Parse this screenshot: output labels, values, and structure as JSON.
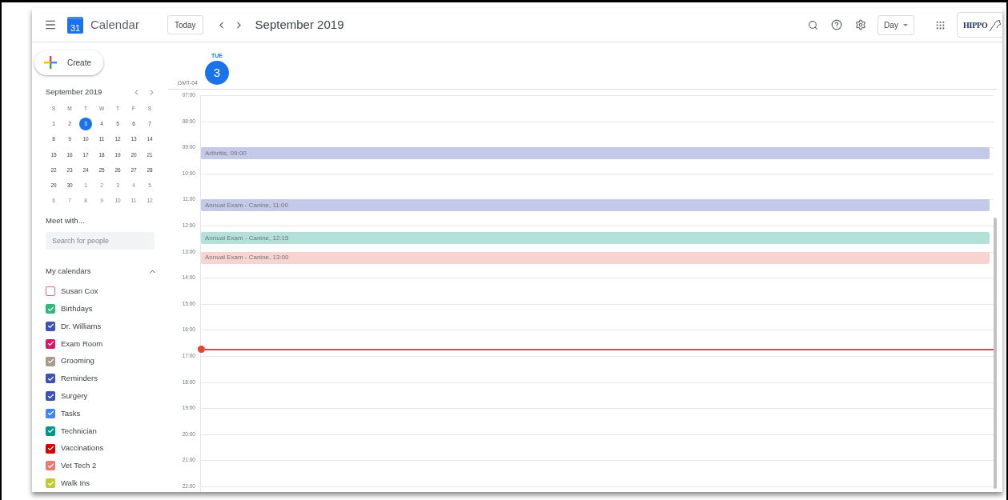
{
  "header": {
    "app_name": "Calendar",
    "logo_day": "31",
    "today_button": "Today",
    "title": "September 2019",
    "view_button": "Day",
    "account_logo": "HIPPO"
  },
  "create_button": "Create",
  "mini_calendar": {
    "title": "September 2019",
    "weekdays": [
      "S",
      "M",
      "T",
      "W",
      "T",
      "F",
      "S"
    ],
    "weeks": [
      [
        {
          "day": "1",
          "muted": false,
          "selected": false
        },
        {
          "day": "2",
          "muted": false,
          "selected": false
        },
        {
          "day": "3",
          "muted": false,
          "selected": true
        },
        {
          "day": "4",
          "muted": false,
          "selected": false
        },
        {
          "day": "5",
          "muted": false,
          "selected": false
        },
        {
          "day": "6",
          "muted": false,
          "selected": false
        },
        {
          "day": "7",
          "muted": false,
          "selected": false
        }
      ],
      [
        {
          "day": "8",
          "muted": false,
          "selected": false
        },
        {
          "day": "9",
          "muted": false,
          "selected": false
        },
        {
          "day": "10",
          "muted": false,
          "selected": false
        },
        {
          "day": "11",
          "muted": false,
          "selected": false
        },
        {
          "day": "12",
          "muted": false,
          "selected": false
        },
        {
          "day": "13",
          "muted": false,
          "selected": false
        },
        {
          "day": "14",
          "muted": false,
          "selected": false
        }
      ],
      [
        {
          "day": "15",
          "muted": false,
          "selected": false
        },
        {
          "day": "16",
          "muted": false,
          "selected": false
        },
        {
          "day": "17",
          "muted": false,
          "selected": false
        },
        {
          "day": "18",
          "muted": false,
          "selected": false
        },
        {
          "day": "19",
          "muted": false,
          "selected": false
        },
        {
          "day": "20",
          "muted": false,
          "selected": false
        },
        {
          "day": "21",
          "muted": false,
          "selected": false
        }
      ],
      [
        {
          "day": "22",
          "muted": false,
          "selected": false
        },
        {
          "day": "23",
          "muted": false,
          "selected": false
        },
        {
          "day": "24",
          "muted": false,
          "selected": false
        },
        {
          "day": "25",
          "muted": false,
          "selected": false
        },
        {
          "day": "26",
          "muted": false,
          "selected": false
        },
        {
          "day": "27",
          "muted": false,
          "selected": false
        },
        {
          "day": "28",
          "muted": false,
          "selected": false
        }
      ],
      [
        {
          "day": "29",
          "muted": false,
          "selected": false
        },
        {
          "day": "30",
          "muted": false,
          "selected": false
        },
        {
          "day": "1",
          "muted": true,
          "selected": false
        },
        {
          "day": "2",
          "muted": true,
          "selected": false
        },
        {
          "day": "3",
          "muted": true,
          "selected": false
        },
        {
          "day": "4",
          "muted": true,
          "selected": false
        },
        {
          "day": "5",
          "muted": true,
          "selected": false
        }
      ],
      [
        {
          "day": "6",
          "muted": true,
          "selected": false
        },
        {
          "day": "7",
          "muted": true,
          "selected": false
        },
        {
          "day": "8",
          "muted": true,
          "selected": false
        },
        {
          "day": "9",
          "muted": true,
          "selected": false
        },
        {
          "day": "10",
          "muted": true,
          "selected": false
        },
        {
          "day": "11",
          "muted": true,
          "selected": false
        },
        {
          "day": "12",
          "muted": true,
          "selected": false
        }
      ]
    ]
  },
  "meet_with": {
    "title": "Meet with...",
    "placeholder": "Search for people"
  },
  "my_calendars": {
    "title": "My calendars",
    "expanded": true,
    "items": [
      {
        "name": "Susan Cox",
        "checked": false,
        "color": "#d665b8"
      },
      {
        "name": "Birthdays",
        "checked": true,
        "color": "#33b679"
      },
      {
        "name": "Dr. Williams",
        "checked": true,
        "color": "#3f51b5"
      },
      {
        "name": "Exam Room",
        "checked": true,
        "color": "#d81b60"
      },
      {
        "name": "Grooming",
        "checked": true,
        "color": "#a79b8e"
      },
      {
        "name": "Reminders",
        "checked": true,
        "color": "#3f51b5"
      },
      {
        "name": "Surgery",
        "checked": true,
        "color": "#3f51b5"
      },
      {
        "name": "Tasks",
        "checked": true,
        "color": "#4285f4"
      },
      {
        "name": "Technician",
        "checked": true,
        "color": "#009688"
      },
      {
        "name": "Vaccinations",
        "checked": true,
        "color": "#d50000"
      },
      {
        "name": "Vet Tech 2",
        "checked": true,
        "color": "#e67c73"
      },
      {
        "name": "Walk Ins",
        "checked": true,
        "color": "#c0ca33"
      }
    ]
  },
  "day_header": {
    "weekday": "TUE",
    "date": "3",
    "timezone": "GMT-04"
  },
  "hours": [
    "07:00",
    "08:00",
    "09:00",
    "10:00",
    "11:00",
    "12:00",
    "13:00",
    "14:00",
    "15:00",
    "16:00",
    "17:00",
    "18:00",
    "19:00",
    "20:00",
    "21:00",
    "22:00"
  ],
  "events": [
    {
      "title": "Arthritis,",
      "time": "09:00",
      "color": "#c5c9e8"
    },
    {
      "title": "Annual Exam - Canine,",
      "time": "11:00",
      "color": "#c5c9e8"
    },
    {
      "title": "Annual Exam - Canine,",
      "time": "12:15",
      "color": "#b3e0d9"
    },
    {
      "title": "Annual Exam - Canine,",
      "time": "13:00",
      "color": "#f7d4cf"
    }
  ]
}
